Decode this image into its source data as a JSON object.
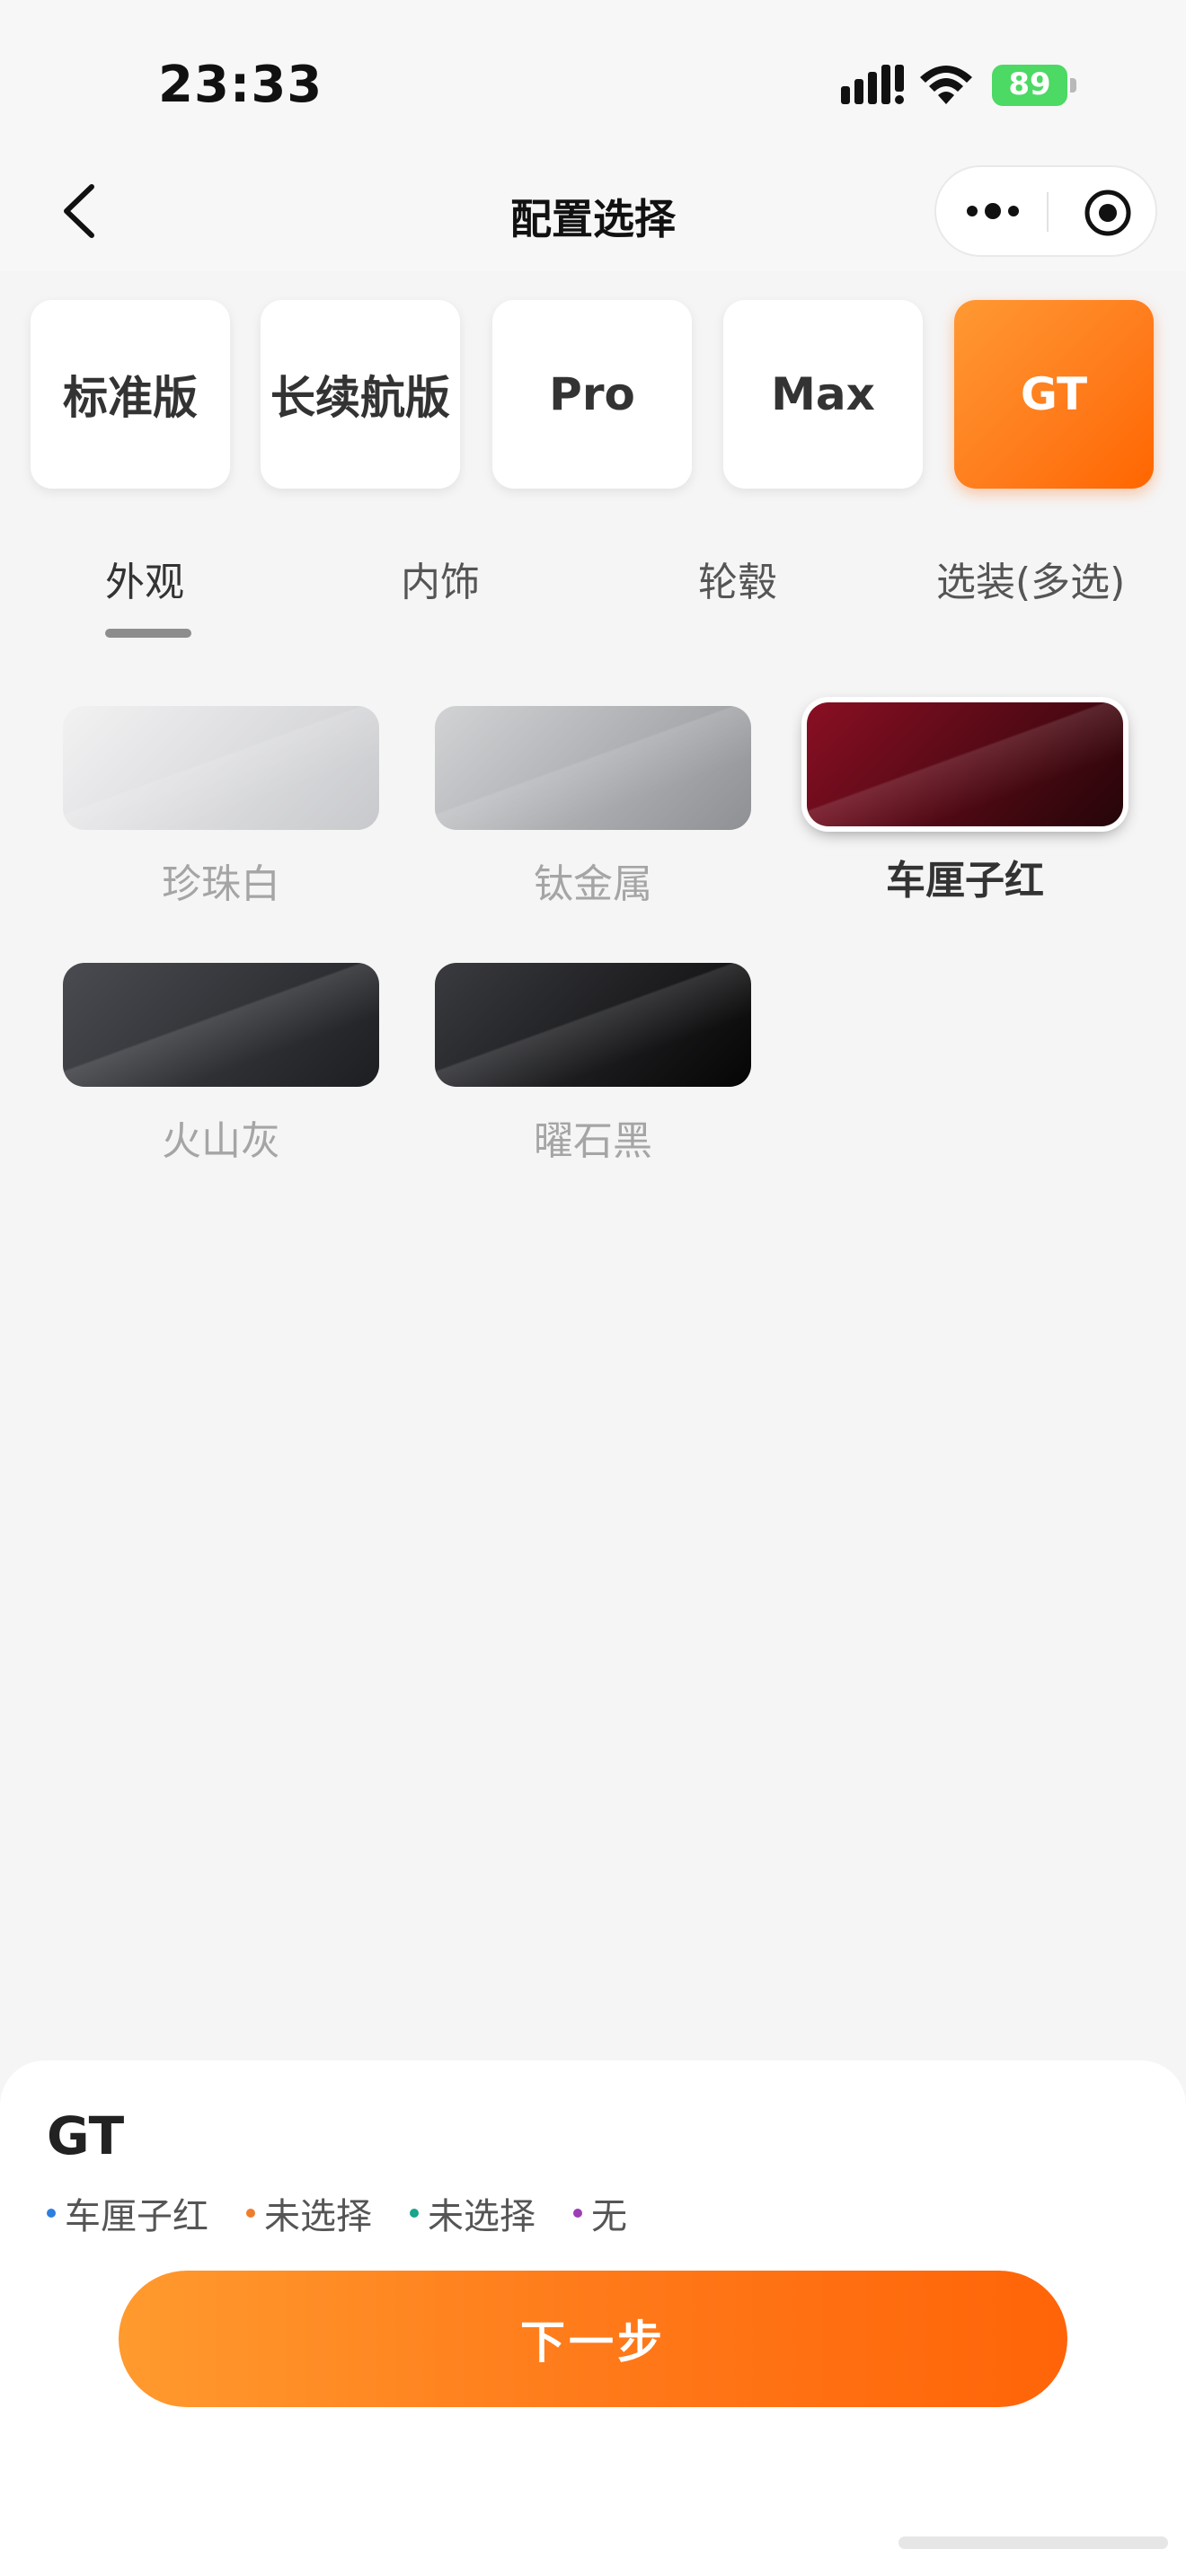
{
  "status_bar": {
    "time": "23:33",
    "battery": "89"
  },
  "navbar": {
    "title": "配置选择"
  },
  "trims": [
    {
      "label": "标准版",
      "active": false
    },
    {
      "label": "长续航版",
      "active": false
    },
    {
      "label": "Pro",
      "active": false
    },
    {
      "label": "Max",
      "active": false
    },
    {
      "label": "GT",
      "active": true
    }
  ],
  "tabs": [
    {
      "label": "外观",
      "active": true
    },
    {
      "label": "内饰",
      "active": false
    },
    {
      "label": "轮毂",
      "active": false
    },
    {
      "label": "选装(多选)",
      "active": false
    }
  ],
  "colors": [
    {
      "name": "珍珠白",
      "selected": false,
      "gradient_from": "#f2f2f3",
      "gradient_to": "#c8c9cc"
    },
    {
      "name": "钛金属",
      "selected": false,
      "gradient_from": "#d2d3d5",
      "gradient_to": "#8e9094"
    },
    {
      "name": "车厘子红",
      "selected": true,
      "gradient_from": "#8a0f24",
      "gradient_to": "#240508"
    },
    {
      "name": "火山灰",
      "selected": false,
      "gradient_from": "#4a4b50",
      "gradient_to": "#1d1e22"
    },
    {
      "name": "曜石黑",
      "selected": false,
      "gradient_from": "#3a3b40",
      "gradient_to": "#050505"
    }
  ],
  "summary": {
    "title": "GT",
    "items": [
      {
        "text": "车厘子红",
        "dot_color": "#2d7fe0"
      },
      {
        "text": "未选择",
        "dot_color": "#f07d2e"
      },
      {
        "text": "未选择",
        "dot_color": "#1aa58c"
      },
      {
        "text": "无",
        "dot_color": "#9b3fb6"
      }
    ],
    "next_label": "下一步"
  },
  "theme": {
    "accent": "#ff7a1a"
  }
}
